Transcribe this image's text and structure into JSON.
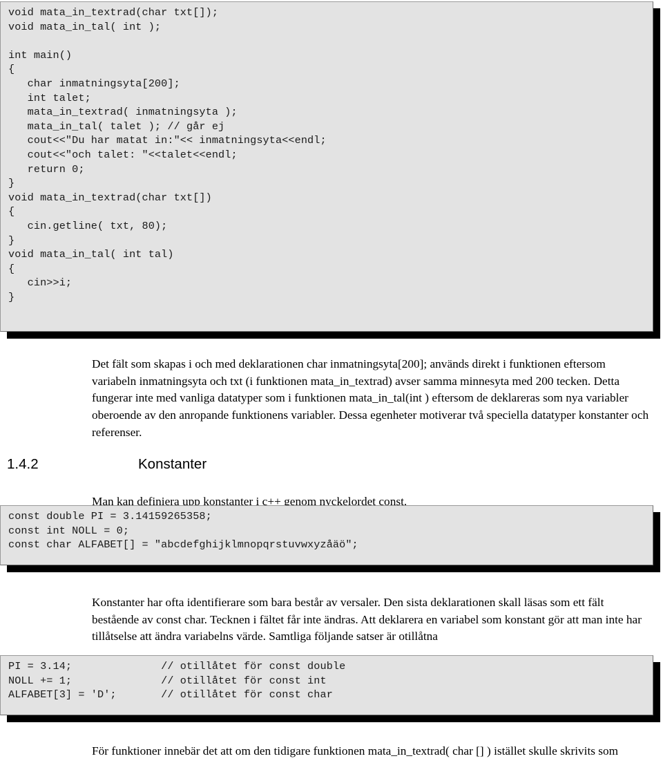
{
  "document": {
    "language": "sv",
    "code_blocks": [
      {
        "id": "code-block-main",
        "lines": "void mata_in_textrad(char txt[]);\nvoid mata_in_tal( int );\n\nint main()\n{\n   char inmatningsyta[200];\n   int talet;\n   mata_in_textrad( inmatningsyta );\n   mata_in_tal( talet ); // går ej\n   cout<<\"Du har matat in:\"<< inmatningsyta<<endl;\n   cout<<\"och talet: \"<<talet<<endl;\n   return 0;\n}\nvoid mata_in_textrad(char txt[])\n{\n   cin.getline( txt, 80);\n}\nvoid mata_in_tal( int tal)\n{\n   cin>>i;\n}"
      },
      {
        "id": "code-block-const-declarations",
        "lines": "const double PI = 3.14159265358;\nconst int NOLL = 0;\nconst char ALFABET[] = \"abcdefghijklmnopqrstuvwxyzåäö\";"
      },
      {
        "id": "code-block-illegal-statements",
        "lines": "PI = 3.14;              // otillåtet för const double\nNOLL += 1;              // otillåtet för const int\nALFABET[3] = 'D';       // otillåtet för const char"
      }
    ],
    "paragraphs": {
      "p_fields": "Det fält som skapas i och med deklarationen char inmatningsyta[200]; används direkt i funktionen eftersom variabeln inmatningsyta och txt (i funktionen mata_in_textrad) avser samma minnesyta med 200 tecken. Detta fungerar inte med vanliga datatyper som i funktionen mata_in_tal(int ) eftersom de deklareras som nya variabler oberoende av den anropande funktionens variabler. Dessa egenheter motiverar två speciella datatyper konstanter och referenser.",
      "p_const_intro": "Man kan definiera upp konstanter i c++ genom nyckelordet const.",
      "p_const_rules": "Konstanter har ofta identifierare som bara består av versaler. Den sista deklarationen skall läsas som ett fält bestående av const char. Tecknen i fältet får inte ändras. Att deklarera en variabel som konstant gör att man inte har tillåtselse att ändra variabelns värde. Samtliga följande satser är otillåtna",
      "p_functions": "För funktioner innebär det att om den tidigare funktionen mata_in_textrad( char [] ) istället skulle skrivits som"
    },
    "heading": {
      "number": "1.4.2",
      "title": "Konstanter"
    },
    "colors": {
      "code_background": "#e3e3e3",
      "code_border": "#9a9a9a",
      "shadow": "#000000",
      "text": "#000000",
      "page_background": "#ffffff"
    }
  }
}
